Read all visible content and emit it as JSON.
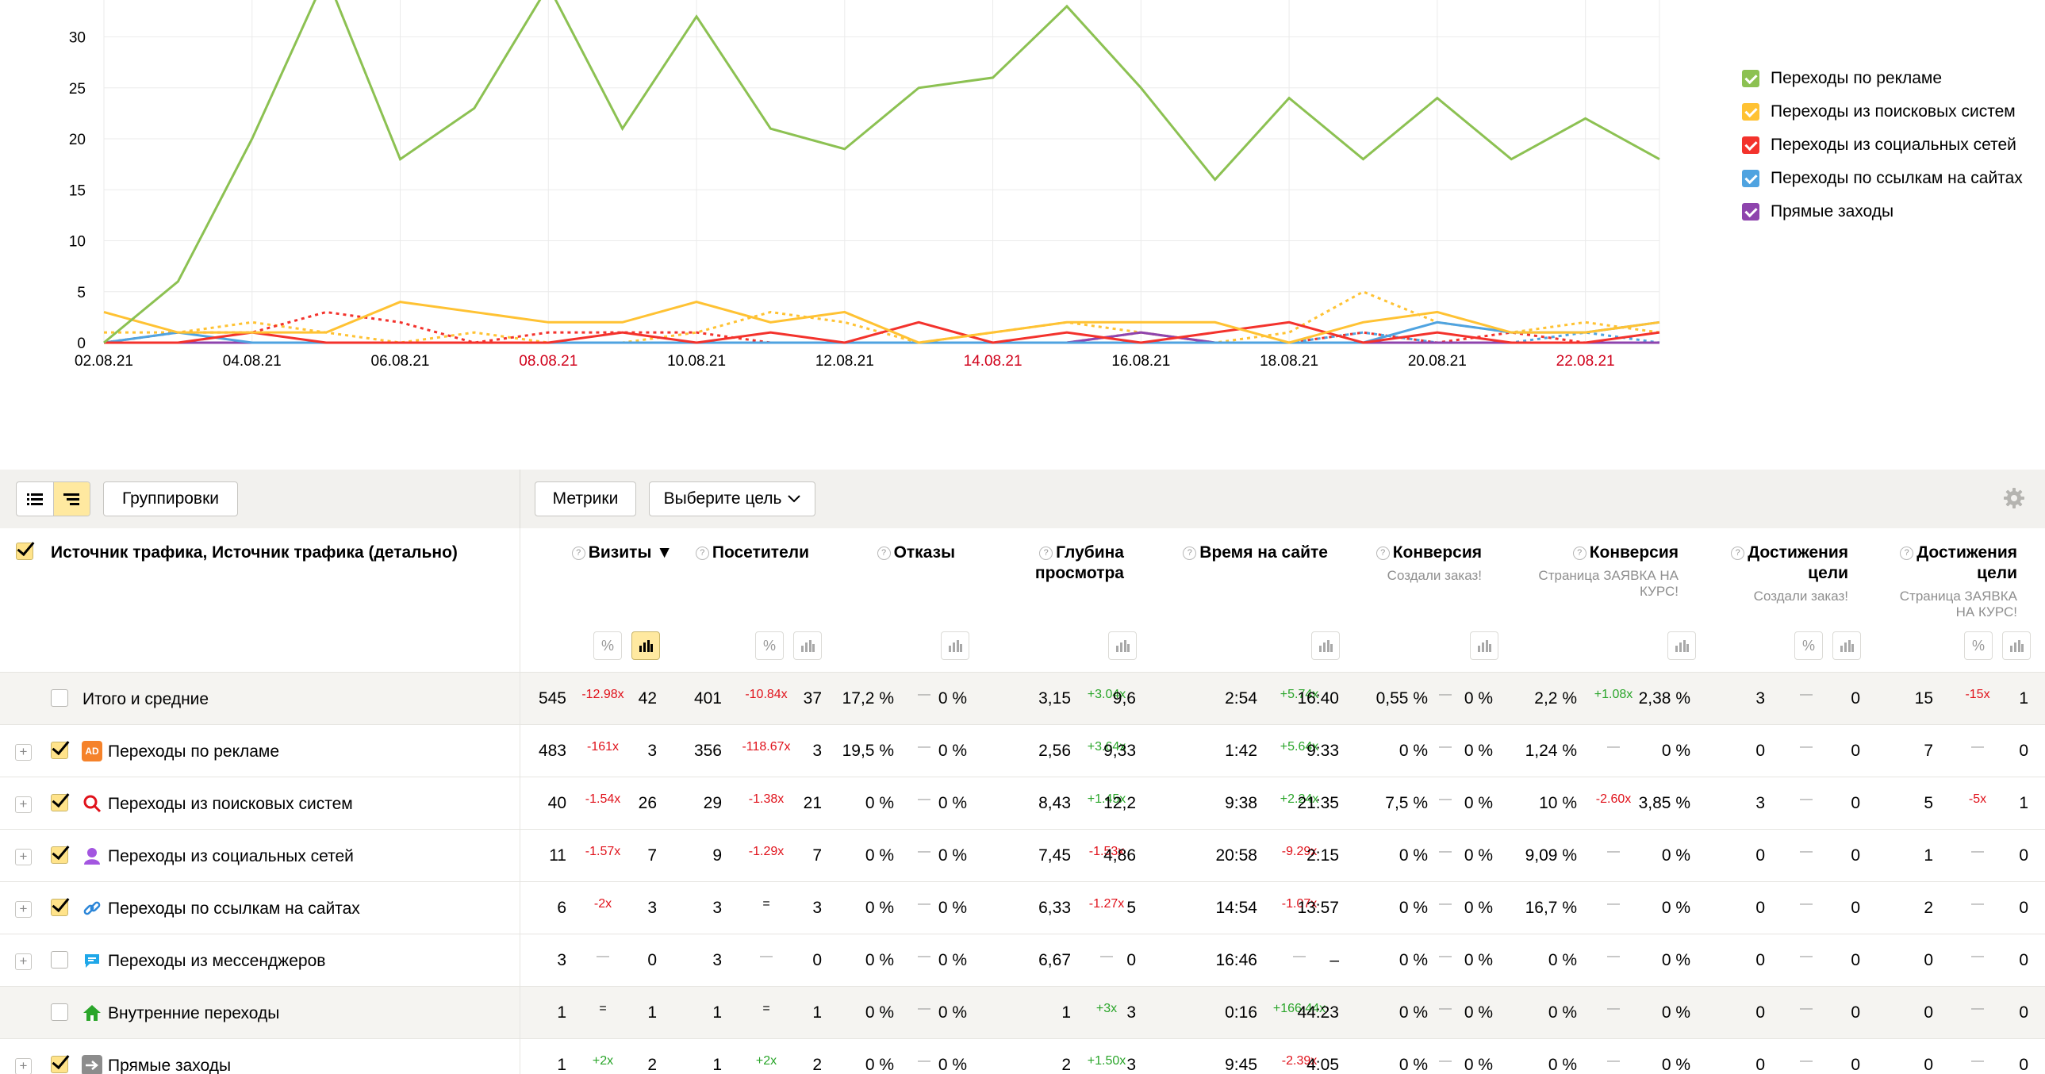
{
  "chart_data": {
    "type": "line",
    "x": [
      "02.08.21",
      "03.08.21",
      "04.08.21",
      "05.08.21",
      "06.08.21",
      "07.08.21",
      "08.08.21",
      "09.08.21",
      "10.08.21",
      "11.08.21",
      "12.08.21",
      "13.08.21",
      "14.08.21",
      "15.08.21",
      "16.08.21",
      "17.08.21",
      "18.08.21",
      "19.08.21",
      "20.08.21",
      "21.08.21",
      "22.08.21",
      "23.08.21"
    ],
    "x_ticks": [
      "02.08.21",
      "04.08.21",
      "06.08.21",
      "08.08.21",
      "10.08.21",
      "12.08.21",
      "14.08.21",
      "16.08.21",
      "18.08.21",
      "20.08.21",
      "22.08.21"
    ],
    "weekend_ticks": [
      "08.08.21",
      "14.08.21",
      "22.08.21"
    ],
    "y_ticks": [
      "0",
      "5",
      "10",
      "15",
      "20",
      "25",
      "30"
    ],
    "ylim": [
      0,
      33.5
    ],
    "series": [
      {
        "name": "Переходы по рекламе",
        "color": "#8cc152",
        "values": [
          0,
          6,
          20,
          36,
          18,
          23,
          35,
          21,
          32,
          21,
          19,
          25,
          26,
          33,
          25,
          16,
          24,
          18,
          24,
          18,
          22,
          18
        ]
      },
      {
        "name": "Переходы из поисковых систем",
        "color": "#ffc233",
        "values": [
          3,
          1,
          1,
          1,
          4,
          3,
          2,
          2,
          4,
          2,
          3,
          0,
          1,
          2,
          2,
          2,
          0,
          2,
          3,
          1,
          1,
          2
        ]
      },
      {
        "name": "Переходы из социальных сетей",
        "color": "#f3322c",
        "values": [
          0,
          0,
          1,
          0,
          0,
          0,
          0,
          1,
          0,
          1,
          0,
          2,
          0,
          1,
          0,
          1,
          2,
          0,
          1,
          0,
          0,
          1
        ]
      },
      {
        "name": "Переходы по ссылкам на сайтах",
        "color": "#4fa3e0",
        "values": [
          0,
          1,
          0,
          0,
          0,
          0,
          0,
          0,
          0,
          0,
          0,
          0,
          0,
          0,
          0,
          0,
          0,
          0,
          2,
          1,
          1,
          2
        ]
      },
      {
        "name": "Прямые заходы",
        "color": "#8e44ad",
        "values": [
          0,
          0,
          0,
          0,
          0,
          0,
          0,
          0,
          0,
          0,
          0,
          0,
          0,
          0,
          1,
          0,
          0,
          0,
          0,
          0,
          0,
          0
        ]
      }
    ],
    "comparison_series": [
      {
        "name": "Переходы из поисковых систем",
        "color": "#ffc233",
        "values": [
          1,
          1,
          2,
          1,
          0,
          1,
          0,
          0,
          1,
          3,
          2,
          0,
          1,
          2,
          1,
          0,
          1,
          5,
          2,
          1,
          2,
          1
        ]
      },
      {
        "name": "Переходы из социальных сетей",
        "color": "#f3322c",
        "values": [
          0,
          1,
          1,
          3,
          2,
          0,
          1,
          1,
          1,
          0,
          0,
          0,
          0,
          0,
          1,
          0,
          0,
          1,
          0,
          1,
          0,
          0
        ]
      },
      {
        "name": "Переходы по ссылкам на сайтах",
        "color": "#4fa3e0",
        "values": [
          0,
          0,
          0,
          0,
          0,
          0,
          0,
          0,
          0,
          0,
          0,
          0,
          0,
          0,
          0,
          0,
          0,
          1,
          0,
          0,
          1,
          0
        ]
      }
    ]
  },
  "legend": [
    {
      "label": "Переходы по рекламе",
      "color": "#8cc152"
    },
    {
      "label": "Переходы из поисковых систем",
      "color": "#ffc233"
    },
    {
      "label": "Переходы из социальных сетей",
      "color": "#f3322c"
    },
    {
      "label": "Переходы по ссылкам на сайтах",
      "color": "#4fa3e0"
    },
    {
      "label": "Прямые заходы",
      "color": "#8e44ad"
    }
  ],
  "toolbar": {
    "groupings_label": "Группировки",
    "metrics_label": "Метрики",
    "goal_label": "Выберите цель"
  },
  "table": {
    "dimension_header": "Источник трафика, Источник трафика (детально)",
    "columns": [
      {
        "title": "Визиты ▼",
        "sub": ""
      },
      {
        "title": "Посетители",
        "sub": ""
      },
      {
        "title": "Отказы",
        "sub": ""
      },
      {
        "title": "Глубина\nпросмотра",
        "sub": ""
      },
      {
        "title": "Время на сайте",
        "sub": ""
      },
      {
        "title": "Конверсия",
        "sub": "Создали заказ!"
      },
      {
        "title": "Конверсия",
        "sub": "Страница ЗАЯВКА НА\nКУРС!"
      },
      {
        "title": "Достижения\nцели",
        "sub": "Создали заказ!"
      },
      {
        "title": "Достижения\nцели",
        "sub": "Страница ЗАЯВКА\nНА КУРС!"
      }
    ],
    "rows": [
      {
        "label": "Итого и средние",
        "kind": "total",
        "checked": false,
        "icon": "",
        "cells": [
          [
            "545",
            "-12.98x",
            "42"
          ],
          [
            "401",
            "-10.84x",
            "37"
          ],
          [
            "17,2 %",
            "—",
            "0 %"
          ],
          [
            "3,15",
            "+3.04x",
            "9,6"
          ],
          [
            "2:54",
            "+5.74x",
            "16:40"
          ],
          [
            "0,55 %",
            "—",
            "0 %"
          ],
          [
            "2,2 %",
            "+1.08x",
            "2,38 %"
          ],
          [
            "3",
            "—",
            "0"
          ],
          [
            "15",
            "-15x",
            "1"
          ]
        ]
      },
      {
        "label": "Переходы по рекламе",
        "kind": "normal",
        "checked": true,
        "icon": "ad-icon",
        "cells": [
          [
            "483",
            "-161x",
            "3"
          ],
          [
            "356",
            "-118.67x",
            "3"
          ],
          [
            "19,5 %",
            "—",
            "0 %"
          ],
          [
            "2,56",
            "+3.64x",
            "9,33"
          ],
          [
            "1:42",
            "+5.64x",
            "9:33"
          ],
          [
            "0 %",
            "—",
            "0 %"
          ],
          [
            "1,24 %",
            "—",
            "0 %"
          ],
          [
            "0",
            "—",
            "0"
          ],
          [
            "7",
            "—",
            "0"
          ]
        ]
      },
      {
        "label": "Переходы из поисковых систем",
        "kind": "normal",
        "checked": true,
        "icon": "search-icon",
        "cells": [
          [
            "40",
            "-1.54x",
            "26"
          ],
          [
            "29",
            "-1.38x",
            "21"
          ],
          [
            "0 %",
            "—",
            "0 %"
          ],
          [
            "8,43",
            "+1.45x",
            "12,2"
          ],
          [
            "9:38",
            "+2.24x",
            "21:35"
          ],
          [
            "7,5 %",
            "—",
            "0 %"
          ],
          [
            "10 %",
            "-2.60x",
            "3,85 %"
          ],
          [
            "3",
            "—",
            "0"
          ],
          [
            "5",
            "-5x",
            "1"
          ]
        ]
      },
      {
        "label": "Переходы из социальных сетей",
        "kind": "normal",
        "checked": true,
        "icon": "social-icon",
        "cells": [
          [
            "11",
            "-1.57x",
            "7"
          ],
          [
            "9",
            "-1.29x",
            "7"
          ],
          [
            "0 %",
            "—",
            "0 %"
          ],
          [
            "7,45",
            "-1.53x",
            "4,86"
          ],
          [
            "20:58",
            "-9.29x",
            "2:15"
          ],
          [
            "0 %",
            "—",
            "0 %"
          ],
          [
            "9,09 %",
            "—",
            "0 %"
          ],
          [
            "0",
            "—",
            "0"
          ],
          [
            "1",
            "—",
            "0"
          ]
        ]
      },
      {
        "label": "Переходы по ссылкам на сайтах",
        "kind": "normal",
        "checked": true,
        "icon": "link-icon",
        "cells": [
          [
            "6",
            "-2x",
            "3"
          ],
          [
            "3",
            "=",
            "3"
          ],
          [
            "0 %",
            "—",
            "0 %"
          ],
          [
            "6,33",
            "-1.27x",
            "5"
          ],
          [
            "14:54",
            "-1.07x",
            "13:57"
          ],
          [
            "0 %",
            "—",
            "0 %"
          ],
          [
            "16,7 %",
            "—",
            "0 %"
          ],
          [
            "0",
            "—",
            "0"
          ],
          [
            "2",
            "—",
            "0"
          ]
        ]
      },
      {
        "label": "Переходы из мессенджеров",
        "kind": "normal",
        "checked": false,
        "icon": "messenger-icon",
        "cells": [
          [
            "3",
            "—",
            "0"
          ],
          [
            "3",
            "—",
            "0"
          ],
          [
            "0 %",
            "—",
            "0 %"
          ],
          [
            "6,67",
            "—",
            "0"
          ],
          [
            "16:46",
            "—",
            "–"
          ],
          [
            "0 %",
            "—",
            "0 %"
          ],
          [
            "0 %",
            "—",
            "0 %"
          ],
          [
            "0",
            "—",
            "0"
          ],
          [
            "0",
            "—",
            "0"
          ]
        ]
      },
      {
        "label": "Внутренние переходы",
        "kind": "shaded",
        "checked": false,
        "icon": "home-icon",
        "cells": [
          [
            "1",
            "=",
            "1"
          ],
          [
            "1",
            "=",
            "1"
          ],
          [
            "0 %",
            "—",
            "0 %"
          ],
          [
            "1",
            "+3x",
            "3"
          ],
          [
            "0:16",
            "+166.44x",
            "44:23"
          ],
          [
            "0 %",
            "—",
            "0 %"
          ],
          [
            "0 %",
            "—",
            "0 %"
          ],
          [
            "0",
            "—",
            "0"
          ],
          [
            "0",
            "—",
            "0"
          ]
        ]
      },
      {
        "label": "Прямые заходы",
        "kind": "normal",
        "checked": true,
        "icon": "direct-icon",
        "cells": [
          [
            "1",
            "+2x",
            "2"
          ],
          [
            "1",
            "+2x",
            "2"
          ],
          [
            "0 %",
            "—",
            "0 %"
          ],
          [
            "2",
            "+1.50x",
            "3"
          ],
          [
            "9:45",
            "-2.39x",
            "4:05"
          ],
          [
            "0 %",
            "—",
            "0 %"
          ],
          [
            "0 %",
            "—",
            "0 %"
          ],
          [
            "0",
            "—",
            "0"
          ],
          [
            "0",
            "—",
            "0"
          ]
        ]
      }
    ]
  }
}
